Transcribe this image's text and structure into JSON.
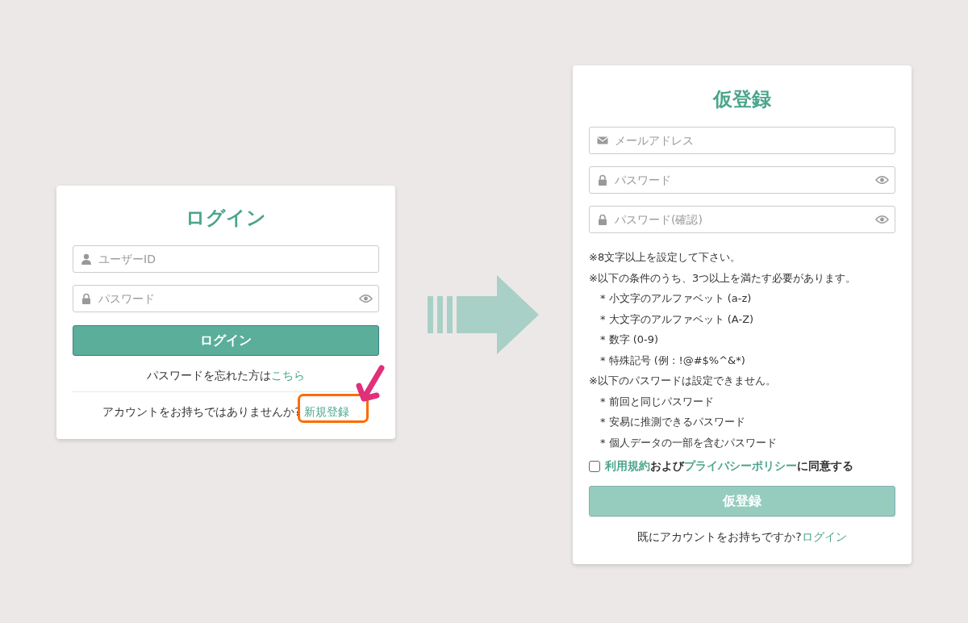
{
  "login": {
    "title": "ログイン",
    "fields": [
      {
        "kind": "user",
        "placeholder": "ユーザーID",
        "reveal": false
      },
      {
        "kind": "lock",
        "placeholder": "パスワード",
        "reveal": true
      }
    ],
    "button": {
      "label": "ログイン",
      "disabled": false
    },
    "forgot": {
      "text": "パスワードを忘れた方は",
      "link": "こちら"
    },
    "signup": {
      "text": "アカウントをお持ちではありませんか?",
      "link": "新規登録",
      "highlighted": true
    }
  },
  "register": {
    "title": "仮登録",
    "fields": [
      {
        "kind": "mail",
        "placeholder": "メールアドレス",
        "reveal": false
      },
      {
        "kind": "lock",
        "placeholder": "パスワード",
        "reveal": true
      },
      {
        "kind": "lock",
        "placeholder": "パスワード(確認)",
        "reveal": true
      }
    ],
    "notes": [
      {
        "kind": "heading",
        "text": "※8文字以上を設定して下さい。"
      },
      {
        "kind": "heading",
        "text": "※以下の条件のうち、3つ以上を満たす必要があります。"
      },
      {
        "kind": "bullet",
        "text": "* 小文字のアルファベット (a-z)"
      },
      {
        "kind": "bullet",
        "text": "* 大文字のアルファベット (A-Z)"
      },
      {
        "kind": "bullet",
        "text": "* 数字 (0-9)"
      },
      {
        "kind": "bullet",
        "text": "* 特殊記号 (例 : !@#$%^&*)"
      },
      {
        "kind": "heading",
        "text": "※以下のパスワードは設定できません。"
      },
      {
        "kind": "bullet",
        "text": "* 前回と同じパスワード"
      },
      {
        "kind": "bullet",
        "text": "* 安易に推測できるパスワード"
      },
      {
        "kind": "bullet",
        "text": "* 個人データの一部を含むパスワード"
      }
    ],
    "agree": {
      "checked": false,
      "parts": [
        {
          "text": "利用規約",
          "link": true
        },
        {
          "text": "および",
          "link": false
        },
        {
          "text": "プライバシーポリシー",
          "link": true
        },
        {
          "text": "に同意する",
          "link": false
        }
      ]
    },
    "button": {
      "label": "仮登録",
      "disabled": true
    },
    "login": {
      "text": "既にアカウントをお持ちですか?",
      "link": "ログイン"
    }
  }
}
